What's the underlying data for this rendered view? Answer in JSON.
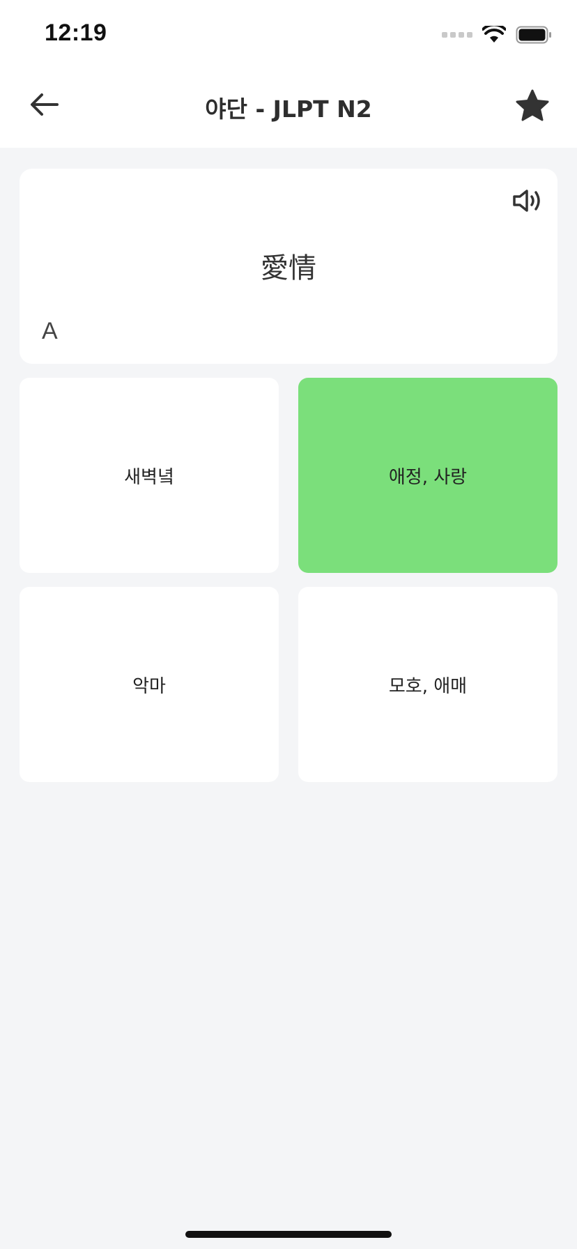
{
  "status_bar": {
    "time": "12:19",
    "icons": [
      "cellular-signal-icon",
      "wifi-icon",
      "battery-icon"
    ]
  },
  "header": {
    "back_icon": "arrow-left-icon",
    "title": "야단 - JLPT N2",
    "favorite_icon": "star-icon"
  },
  "question": {
    "word": "愛情",
    "label": "A",
    "sound_icon": "speaker-icon"
  },
  "options": [
    {
      "text": "새벽녘",
      "state": "default"
    },
    {
      "text": "애정, 사랑",
      "state": "correct"
    },
    {
      "text": "악마",
      "state": "default"
    },
    {
      "text": "모호, 애매",
      "state": "default"
    }
  ],
  "colors": {
    "background": "#f4f5f7",
    "surface": "#ffffff",
    "correct": "#7bdf7b",
    "text": "#222222"
  }
}
